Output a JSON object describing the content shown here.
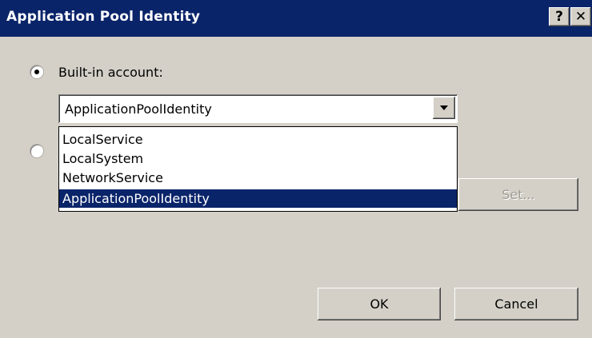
{
  "window": {
    "title": "Application Pool Identity",
    "help_label": "?",
    "close_label": "✕"
  },
  "identity": {
    "builtin_label": "Built-in account:",
    "builtin_selected": true,
    "custom_selected": false,
    "combo_value": "ApplicationPoolIdentity",
    "options": [
      "LocalService",
      "LocalSystem",
      "NetworkService",
      "ApplicationPoolIdentity"
    ],
    "highlighted_option": "ApplicationPoolIdentity"
  },
  "buttons": {
    "set_label": "Set...",
    "ok_label": "OK",
    "cancel_label": "Cancel"
  },
  "colors": {
    "titlebar": "#0a246a",
    "face": "#d4d0c8",
    "selection": "#0a246a"
  }
}
